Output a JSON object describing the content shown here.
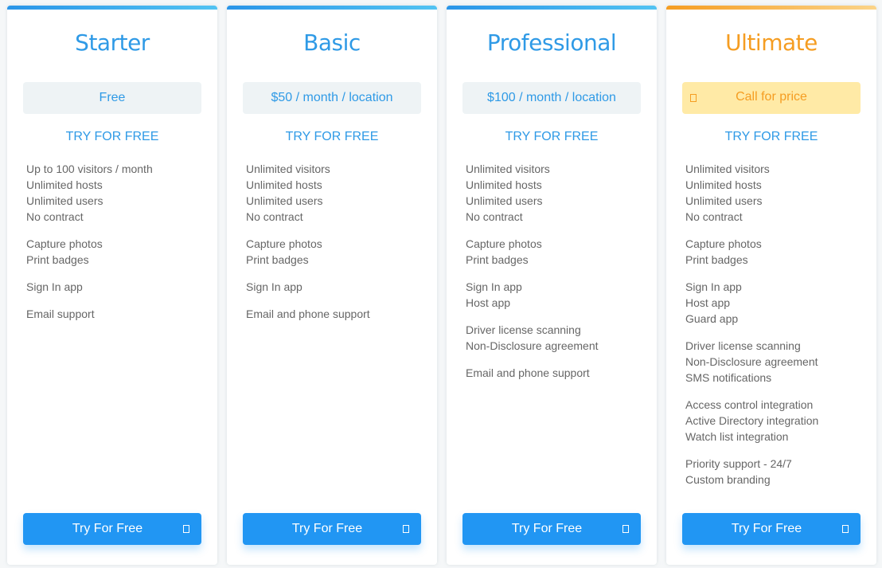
{
  "plans": [
    {
      "name": "Starter",
      "price": "Free",
      "try_link": "TRY FOR FREE",
      "feature_groups": [
        [
          "Up to 100 visitors / month",
          "Unlimited hosts",
          "Unlimited users",
          "No contract"
        ],
        [
          "Capture photos",
          "Print badges"
        ],
        [
          "Sign In app"
        ],
        [
          "Email support"
        ]
      ],
      "cta": "Try For Free"
    },
    {
      "name": "Basic",
      "price": "$50 / month / location",
      "try_link": "TRY FOR FREE",
      "feature_groups": [
        [
          "Unlimited visitors",
          "Unlimited hosts",
          "Unlimited users",
          "No contract"
        ],
        [
          "Capture photos",
          "Print badges"
        ],
        [
          "Sign In app"
        ],
        [
          "Email and phone support"
        ]
      ],
      "cta": "Try For Free"
    },
    {
      "name": "Professional",
      "price": "$100 / month / location",
      "try_link": "TRY FOR FREE",
      "feature_groups": [
        [
          "Unlimited visitors",
          "Unlimited hosts",
          "Unlimited users",
          "No contract"
        ],
        [
          "Capture photos",
          "Print badges"
        ],
        [
          "Sign In app",
          "Host app"
        ],
        [
          "Driver license scanning",
          "Non-Disclosure agreement"
        ],
        [
          "Email and phone support"
        ]
      ],
      "cta": "Try For Free"
    },
    {
      "name": "Ultimate",
      "price": "Call for price",
      "price_icon": "phone-icon",
      "try_link": "TRY FOR FREE",
      "feature_groups": [
        [
          "Unlimited visitors",
          "Unlimited hosts",
          "Unlimited users",
          "No contract"
        ],
        [
          "Capture photos",
          "Print badges"
        ],
        [
          "Sign In app",
          "Host app",
          "Guard app"
        ],
        [
          "Driver license scanning",
          "Non-Disclosure agreement",
          "SMS notifications"
        ],
        [
          "Access control integration",
          "Active Directory integration",
          "Watch list integration"
        ],
        [
          "Priority support - 24/7",
          "Custom branding"
        ]
      ],
      "cta": "Try For Free"
    }
  ],
  "colors": {
    "accent_blue": "#2f9ae6",
    "button_blue": "#2196f3",
    "accent_orange": "#f59d22",
    "price_bg": "#eef3f5",
    "price_bg_ultimate": "#ffeaa6",
    "feature_text": "#666666"
  }
}
